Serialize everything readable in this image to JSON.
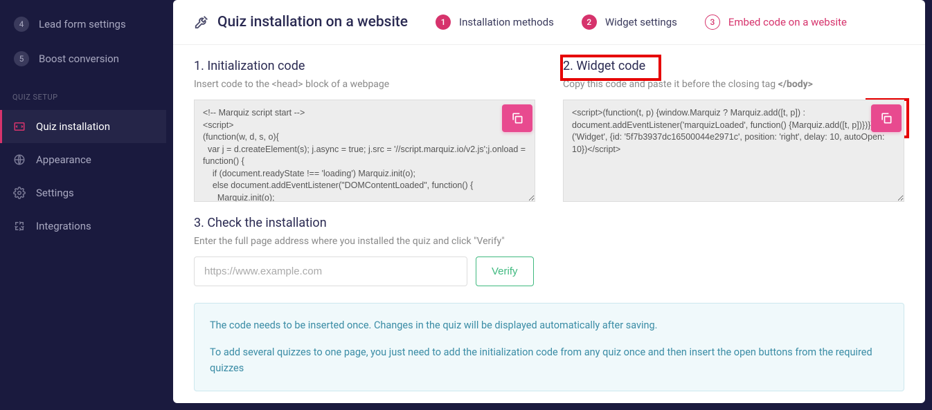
{
  "sidebar": {
    "steps": [
      {
        "num": "4",
        "label": "Lead form settings"
      },
      {
        "num": "5",
        "label": "Boost conversion"
      }
    ],
    "section_label": "QUIZ SETUP",
    "items": [
      {
        "label": "Quiz installation",
        "active": true
      },
      {
        "label": "Appearance",
        "active": false
      },
      {
        "label": "Settings",
        "active": false
      },
      {
        "label": "Integrations",
        "active": false
      }
    ]
  },
  "header": {
    "title": "Quiz installation on a website",
    "steps": [
      {
        "num": "1",
        "label": "Installation methods",
        "current": false
      },
      {
        "num": "2",
        "label": "Widget settings",
        "current": false
      },
      {
        "num": "3",
        "label": "Embed code on a website",
        "current": true
      }
    ]
  },
  "sections": {
    "init": {
      "title": "1. Initialization code",
      "desc": "Insert code to the <head> block of a webpage",
      "code": "<!-- Marquiz script start -->\n<script>\n(function(w, d, s, o){\n  var j = d.createElement(s); j.async = true; j.src = '//script.marquiz.io/v2.js';j.onload = function() {\n    if (document.readyState !== 'loading') Marquiz.init(o);\n    else document.addEventListener(\"DOMContentLoaded\", function() {\n      Marquiz.init(o);"
    },
    "widget": {
      "title": "2. Widget code",
      "desc_pre": "Copy this code and paste it before the closing tag ",
      "desc_bold": "</body>",
      "code": "<script>(function(t, p) {window.Marquiz ? Marquiz.add([t, p]) : document.addEventListener('marquizLoaded', function() {Marquiz.add([t, p])})})('Widget', {id: '5f7b3937dc16500044e2971c', position: 'right', delay: 10, autoOpen: 10})</script>"
    },
    "check": {
      "title": "3. Check the installation",
      "desc": "Enter the full page address where you installed the quiz and click \"Verify\"",
      "placeholder": "https://www.example.com",
      "verify_label": "Verify"
    },
    "info": {
      "p1": "The code needs to be inserted once. Changes in the quiz will be displayed automatically after saving.",
      "p2": "To add several quizzes to one page, you just need to add the initialization code from any quiz once and then insert the open buttons from the required quizzes"
    }
  }
}
